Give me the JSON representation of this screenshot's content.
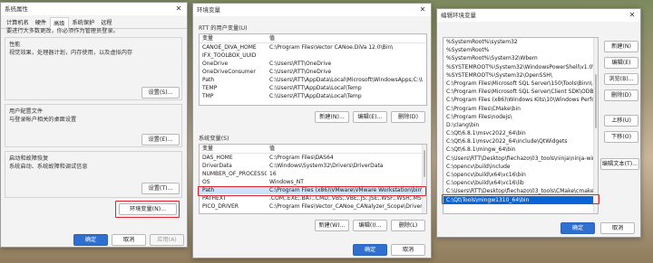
{
  "sysprops": {
    "title": "系统属性",
    "close_glyph": "✕",
    "tabs": [
      "计算机名",
      "硬件",
      "高级",
      "系统保护",
      "远程"
    ],
    "admin_note": "要进行大多数更改，你必须作为管理员登录。",
    "performance": {
      "title": "性能",
      "desc": "视觉效果，处理器计划，内存使用，以及虚拟内存",
      "button": "设置(S)..."
    },
    "profiles": {
      "title": "用户配置文件",
      "desc": "与登录帐户相关的桌面设置",
      "button": "设置(E)..."
    },
    "startup": {
      "title": "启动和故障恢复",
      "desc": "系统启动、系统故障和调试信息",
      "button": "设置(T)..."
    },
    "env_button": "环境变量(N)...",
    "ok": "确定",
    "cancel": "取消",
    "apply": "应用(A)"
  },
  "envvars": {
    "title": "环境变量",
    "close_glyph": "✕",
    "user_section_label": "RTT 的用户变量(U)",
    "user_headers": [
      "变量",
      "值"
    ],
    "user_rows": [
      [
        "CANOE_DIVA_HOME",
        "C:\\Program Files\\Vector CANoe.DiVa 12.0\\Bin\\"
      ],
      [
        "IFX_TOOLBOX_UUID",
        ""
      ],
      [
        "OneDrive",
        "C:\\Users\\RTT\\OneDrive"
      ],
      [
        "OneDriveConsumer",
        "C:\\Users\\RTT\\OneDrive"
      ],
      [
        "Path",
        "C:\\Users\\RTT\\AppData\\Local\\Microsoft\\WindowsApps;C:\\Users\\RTT\\..."
      ],
      [
        "TEMP",
        "C:\\Users\\RTT\\AppData\\Local\\Temp"
      ],
      [
        "TMP",
        "C:\\Users\\RTT\\AppData\\Local\\Temp"
      ]
    ],
    "user_buttons": [
      "新建(N)...",
      "编辑(E)...",
      "删除(D)"
    ],
    "sys_section_label": "系统变量(S)",
    "sys_headers": [
      "变量",
      "值"
    ],
    "sys_rows": [
      [
        "DAS_HOME",
        "C:\\Program Files\\DAS64"
      ],
      [
        "DriverData",
        "C:\\Windows\\System32\\Drivers\\DriverData"
      ],
      [
        "NUMBER_OF_PROCESSORS",
        "16"
      ],
      [
        "OS",
        "Windows_NT"
      ],
      [
        "Path",
        "C:\\Program Files (x86)\\VMware\\VMware Workstation\\bin\\;C:\\..."
      ],
      [
        "PATHEXT",
        ".COM;.EXE;.BAT;.CMD;.VBS;.VBE;.JS;.JSE;.WSF;.WSH;.MSC"
      ],
      [
        "PICO_DRIVER",
        "C:\\Program Files\\Vector_CANoe_CANalyzer_Scope\\Drivers"
      ]
    ],
    "sys_buttons": [
      "新建(W)...",
      "编辑(I)...",
      "删除(L)"
    ],
    "ok": "确定",
    "cancel": "取消"
  },
  "editenv": {
    "title": "编辑环境变量",
    "close_glyph": "✕",
    "paths": [
      "%SystemRoot%\\system32",
      "%SystemRoot%",
      "%SystemRoot%\\System32\\Wbem",
      "%SYSTEMROOT%\\System32\\WindowsPowerShell\\v1.0\\",
      "%SYSTEMROOT%\\System32\\OpenSSH\\",
      "C:\\Program Files\\Microsoft SQL Server\\150\\Tools\\Binn\\",
      "C:\\Program Files\\Microsoft SQL Server\\Client SDK\\ODBC\\17...",
      "C:\\Program Files (x86)\\Windows Kits\\10\\Windows Performan...",
      "C:\\Program Files\\CMake\\bin",
      "C:\\Program Files\\nodejs\\",
      "D:\\clang\\bin",
      "C:\\Qt\\6.8.1\\msvc2022_64\\bin",
      "C:\\Qt\\6.8.1\\msvc2022_64\\include\\QtWidgets",
      "C:\\Qt\\6.8.1\\mingw_64\\bin",
      "C:\\Users\\RTT\\Desktop\\fiechazo\\03_tools\\ninja\\ninja-win",
      "C:\\opencv\\build\\include",
      "C:\\opencv\\build\\x64\\vc16\\bin",
      "C:\\opencv\\build\\x64\\vc16\\lib",
      "C:\\Users\\RTT\\Desktop\\fiechazo\\03_tools\\CMake\\cmake-4.0...",
      "C:\\Qt\\Tools\\mingw1310_64\\bin"
    ],
    "buttons": [
      "新建(N)",
      "编辑(E)",
      "浏览(B)...",
      "删除(D)",
      "上移(U)",
      "下移(O)",
      "编辑文本(T)..."
    ],
    "ok": "确定",
    "cancel": "取消"
  }
}
